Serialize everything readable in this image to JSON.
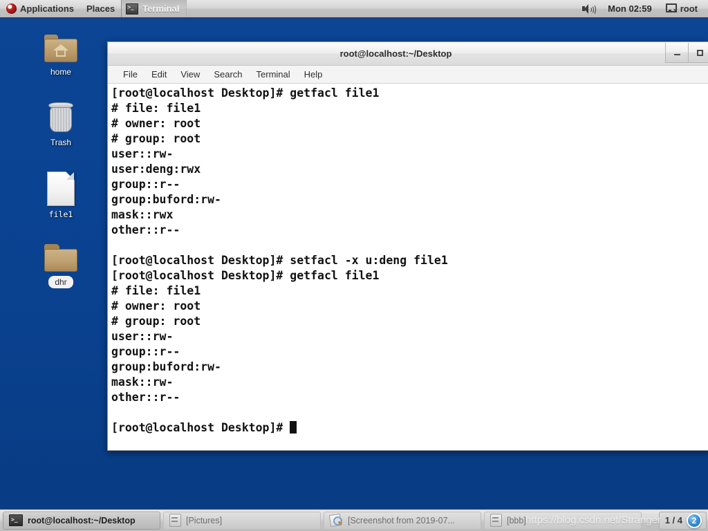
{
  "top_panel": {
    "applications_label": "Applications",
    "places_label": "Places",
    "active_window_label": "Terminal",
    "clock": "Mon 02:59",
    "user_label": "root"
  },
  "desktop": {
    "icons": [
      {
        "label": "home",
        "type": "home-folder"
      },
      {
        "label": "Trash",
        "type": "trash"
      },
      {
        "label": "file1",
        "type": "file"
      },
      {
        "label": "dhr",
        "type": "folder"
      }
    ]
  },
  "terminal_window": {
    "title": "root@localhost:~/Desktop",
    "menu": [
      "File",
      "Edit",
      "View",
      "Search",
      "Terminal",
      "Help"
    ],
    "window_buttons": {
      "minimize": "minimize",
      "maximize": "maximize"
    },
    "content": "[root@localhost Desktop]# getfacl file1\n# file: file1\n# owner: root\n# group: root\nuser::rw-\nuser:deng:rwx\ngroup::r--\ngroup:buford:rw-\nmask::rwx\nother::r--\n\n[root@localhost Desktop]# setfacl -x u:deng file1\n[root@localhost Desktop]# getfacl file1\n# file: file1\n# owner: root\n# group: root\nuser::rw-\ngroup::r--\ngroup:buford:rw-\nmask::rw-\nother::r--\n\n",
    "prompt": "[root@localhost Desktop]# "
  },
  "taskbar": {
    "windows": [
      {
        "label": "root@localhost:~/Desktop",
        "icon": "terminal-icon",
        "active": true
      },
      {
        "label": "[Pictures]",
        "icon": "files-icon",
        "active": false
      },
      {
        "label": "[Screenshot from 2019-07...",
        "icon": "screenshot-icon",
        "active": false
      },
      {
        "label": "[bbb]",
        "icon": "files-icon",
        "active": false
      }
    ],
    "workspace_indicator": "1 / 4",
    "workspace_badge": "2"
  },
  "watermark": "https://blog.csdn.net/Stranger",
  "colors": {
    "desktop_blue": "#08418c",
    "panel_grey": "#d6d6d6",
    "terminal_bg": "#ffffff",
    "terminal_fg": "#111111",
    "badge_blue": "#3b92d8"
  }
}
